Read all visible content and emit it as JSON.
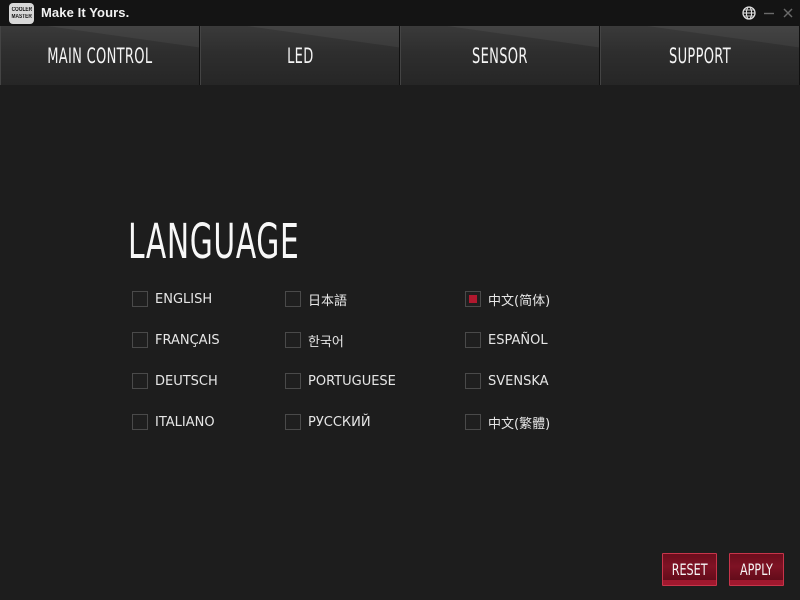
{
  "brand": {
    "logo_line1": "COOLER",
    "logo_line2": "MASTER",
    "tagline": "Make It Yours."
  },
  "window_controls": [
    "globe-icon",
    "minimize-icon",
    "close-icon"
  ],
  "nav": {
    "tabs": [
      {
        "label": "MAIN CONTROL"
      },
      {
        "label": "LED"
      },
      {
        "label": "SENSOR"
      },
      {
        "label": "SUPPORT"
      }
    ]
  },
  "language": {
    "title": "LANGUAGE",
    "selected": "中文(简体)",
    "options": [
      {
        "label": "ENGLISH",
        "checked": false
      },
      {
        "label": "FRANÇAIS",
        "checked": false
      },
      {
        "label": "DEUTSCH",
        "checked": false
      },
      {
        "label": "ITALIANO",
        "checked": false
      },
      {
        "label": "日本語",
        "checked": false
      },
      {
        "label": "한국어",
        "checked": false
      },
      {
        "label": "PORTUGUESE",
        "checked": false
      },
      {
        "label": "РУССКИЙ",
        "checked": false
      },
      {
        "label": "中文(简体)",
        "checked": true
      },
      {
        "label": "ESPAÑOL",
        "checked": false
      },
      {
        "label": "SVENSKA",
        "checked": false
      },
      {
        "label": "中文(繁體)",
        "checked": false
      }
    ]
  },
  "actions": {
    "reset_label": "RESET",
    "apply_label": "APPLY"
  },
  "colors": {
    "accent": "#b0182e",
    "background": "#1d1d1d",
    "titlebar": "#141414"
  }
}
